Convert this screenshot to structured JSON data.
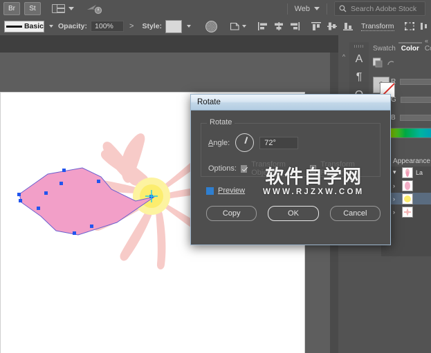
{
  "topbar": {
    "bridge_label": "Br",
    "stock_label": "St",
    "arrange_icon": "arrange-documents-icon",
    "arrange_caret": "chevron-down-icon",
    "cloud_icon": "adobe-stock-sync-icon",
    "web_label": "Web",
    "web_caret": "chevron-down-icon",
    "search_icon": "search-icon",
    "search_placeholder": "Search Adobe Stock"
  },
  "controlbar": {
    "brush_label": "Basic",
    "brush_caret": "chevron-down-icon",
    "opacity_label": "Opacity:",
    "opacity_value": "100%",
    "opacity_arrow": ">",
    "style_label": "Style:",
    "style_caret": "chevron-down-icon",
    "recolor_icon": "recolor-artwork-icon",
    "shape_icon": "shape-options-icon",
    "shape_caret": "chevron-down-icon",
    "align_left_icon": "align-left-icon",
    "align_hcenter_icon": "align-horizontal-center-icon",
    "align_right_icon": "align-right-icon",
    "align_top_icon": "align-top-icon",
    "align_vcenter_icon": "align-vertical-center-icon",
    "align_bottom_icon": "align-bottom-icon",
    "transform_label": "Transform",
    "distribute_icon": "distribute-spacing-icon",
    "more_icon": "more-options-icon"
  },
  "rightdock": {
    "collapse_icon": "collapse-panels-icon",
    "expand_icon": "expand-panel-chevron-icon",
    "type_icons": [
      "character-panel-icon",
      "paragraph-panel-icon",
      "opentype-panel-icon"
    ],
    "type_glyphs": [
      "A",
      "¶",
      "O"
    ],
    "tabs": [
      {
        "label": "Swatch",
        "active": false
      },
      {
        "label": "Color",
        "active": true
      },
      {
        "label": "Co",
        "active": false
      }
    ],
    "color_panel": {
      "fill_stroke_icon": "fill-stroke-swatch-icon",
      "swap_icon": "swap-fill-stroke-icon",
      "help_icon": "help-icon",
      "none_icon": "none-swatch-icon",
      "channels": [
        {
          "label": "R",
          "value": ""
        },
        {
          "label": "G",
          "value": ""
        },
        {
          "label": "B",
          "value": ""
        }
      ],
      "spectrum_icon": "color-spectrum-bar"
    },
    "appearance_tab": "Appearance",
    "layers": {
      "parent": {
        "name": "La",
        "expand_icon": "chevron-down-icon",
        "thumb": "layer-thumbnail"
      },
      "rows": [
        {
          "expand_icon": "chevron-right-icon",
          "thumb": "path-thumbnail-pink",
          "selected": false
        },
        {
          "expand_icon": "chevron-right-icon",
          "thumb": "path-thumbnail-yellow",
          "selected": true
        },
        {
          "expand_icon": "chevron-right-icon",
          "thumb": "path-thumbnail-rose",
          "selected": false
        }
      ]
    }
  },
  "dialog": {
    "title": "Rotate",
    "section_legend": "Rotate",
    "angle_label": "Angle:",
    "angle_dial_icon": "angle-dial-icon",
    "angle_value": "72°",
    "options_label": "Options:",
    "transform_objects_label": "Transform Objects",
    "transform_objects_checked": true,
    "transform_patterns_label": "Transform Patterns",
    "transform_patterns_checked": false,
    "preview_label": "Preview",
    "preview_checked": true,
    "buttons": [
      {
        "label": "Copy",
        "default": false
      },
      {
        "label": "OK",
        "default": true
      },
      {
        "label": "Cancel",
        "default": false
      }
    ]
  },
  "watermark": {
    "cn": "软件自学网",
    "en": "WWW.RJZXW.COM"
  },
  "artwork": {
    "name": "flower-illustration",
    "petal_color": "#f6c9c6",
    "selected_petal_color": "#f29fc8",
    "center_color": "#fdf08a",
    "anchor_color": "#2255ee"
  },
  "colors": {
    "chrome": "#535353",
    "canvas": "#5e5e5e",
    "dialog_bg": "#4e4e4e",
    "title_bar": "#c2d7e8",
    "selection_blue": "#5a6c80"
  }
}
